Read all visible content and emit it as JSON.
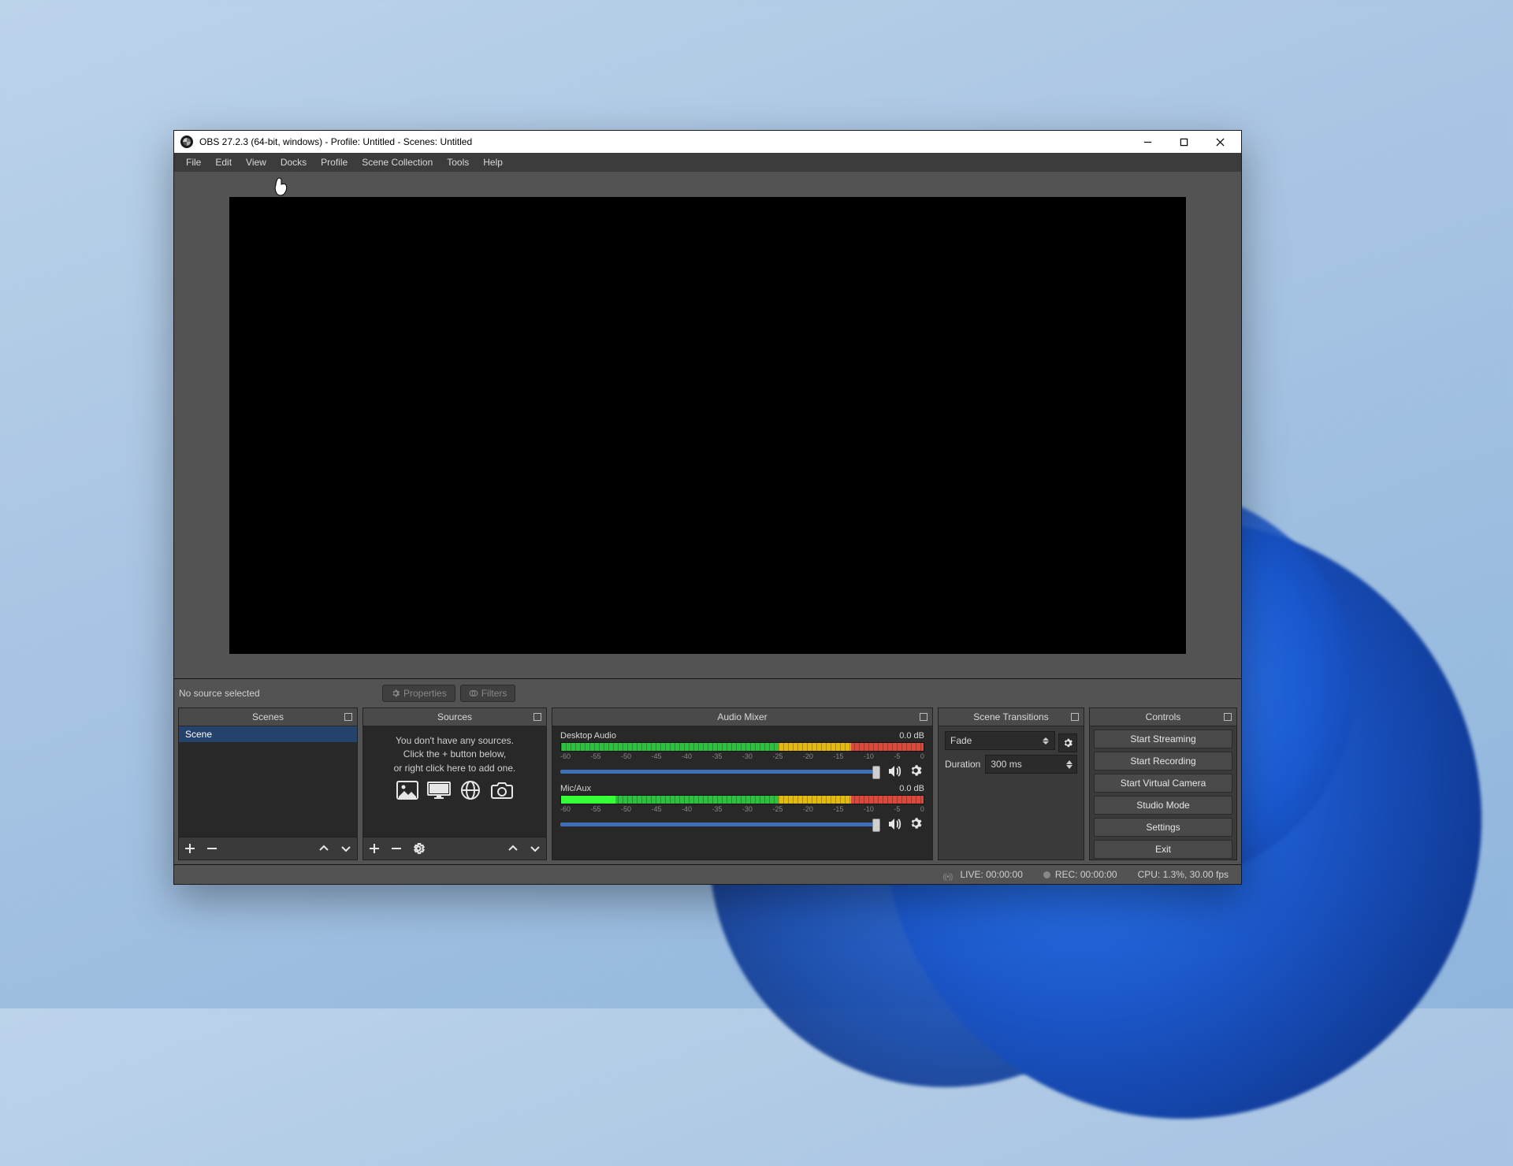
{
  "window": {
    "title": "OBS 27.2.3 (64-bit, windows) - Profile: Untitled - Scenes: Untitled"
  },
  "menu": {
    "items": [
      "File",
      "Edit",
      "View",
      "Docks",
      "Profile",
      "Scene Collection",
      "Tools",
      "Help"
    ]
  },
  "properties_strip": {
    "no_source": "No source selected",
    "properties_btn": "Properties",
    "filters_btn": "Filters"
  },
  "docks": {
    "scenes": {
      "title": "Scenes",
      "items": [
        "Scene"
      ]
    },
    "sources": {
      "title": "Sources",
      "empty_line1": "You don't have any sources.",
      "empty_line2": "Click the + button below,",
      "empty_line3": "or right click here to add one."
    },
    "mixer": {
      "title": "Audio Mixer",
      "channels": [
        {
          "name": "Desktop Audio",
          "level": "0.0 dB"
        },
        {
          "name": "Mic/Aux",
          "level": "0.0 dB"
        }
      ],
      "ticks": [
        "-60",
        "-55",
        "-50",
        "-45",
        "-40",
        "-35",
        "-30",
        "-25",
        "-20",
        "-15",
        "-10",
        "-5",
        "0"
      ]
    },
    "transitions": {
      "title": "Scene Transitions",
      "current": "Fade",
      "duration_label": "Duration",
      "duration_value": "300 ms"
    },
    "controls": {
      "title": "Controls",
      "buttons": [
        "Start Streaming",
        "Start Recording",
        "Start Virtual Camera",
        "Studio Mode",
        "Settings",
        "Exit"
      ]
    }
  },
  "status": {
    "live": "LIVE: 00:00:00",
    "rec": "REC: 00:00:00",
    "cpu": "CPU: 1.3%, 30.00 fps"
  }
}
